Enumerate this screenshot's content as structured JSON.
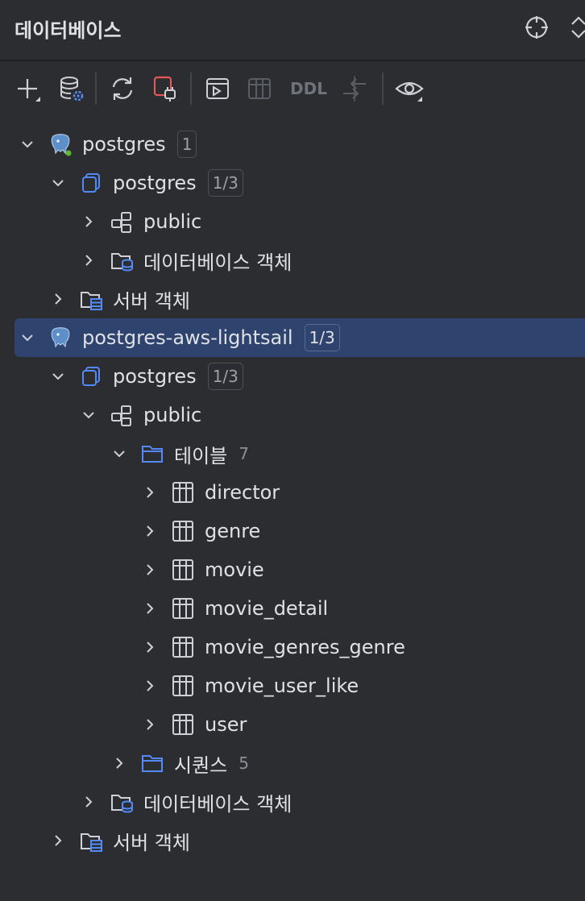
{
  "header": {
    "title": "데이터베이스"
  },
  "toolbar": {
    "ddl_label": "DDL"
  },
  "tree": [
    {
      "label": "postgres",
      "badge": "1",
      "expanded": true
    },
    {
      "label": "postgres",
      "badge": "1/3",
      "expanded": true
    },
    {
      "label": "public",
      "expanded": false
    },
    {
      "label": "데이터베이스 객체",
      "expanded": false
    },
    {
      "label": "서버 객체",
      "expanded": false
    },
    {
      "label": "postgres-aws-lightsail",
      "badge": "1/3",
      "expanded": true,
      "selected": true
    },
    {
      "label": "postgres",
      "badge": "1/3",
      "expanded": true
    },
    {
      "label": "public",
      "expanded": true
    },
    {
      "label": "테이블",
      "count": "7",
      "expanded": true
    },
    {
      "label": "director"
    },
    {
      "label": "genre"
    },
    {
      "label": "movie"
    },
    {
      "label": "movie_detail"
    },
    {
      "label": "movie_genres_genre"
    },
    {
      "label": "movie_user_like"
    },
    {
      "label": "user"
    },
    {
      "label": "시퀀스",
      "count": "5"
    },
    {
      "label": "데이터베이스 객체"
    },
    {
      "label": "서버 객체"
    }
  ],
  "colors": {
    "background": "#2b2d30",
    "selection": "#2e436e",
    "accent_blue": "#548af7",
    "error_red": "#e55757",
    "status_green": "#5fb832"
  }
}
